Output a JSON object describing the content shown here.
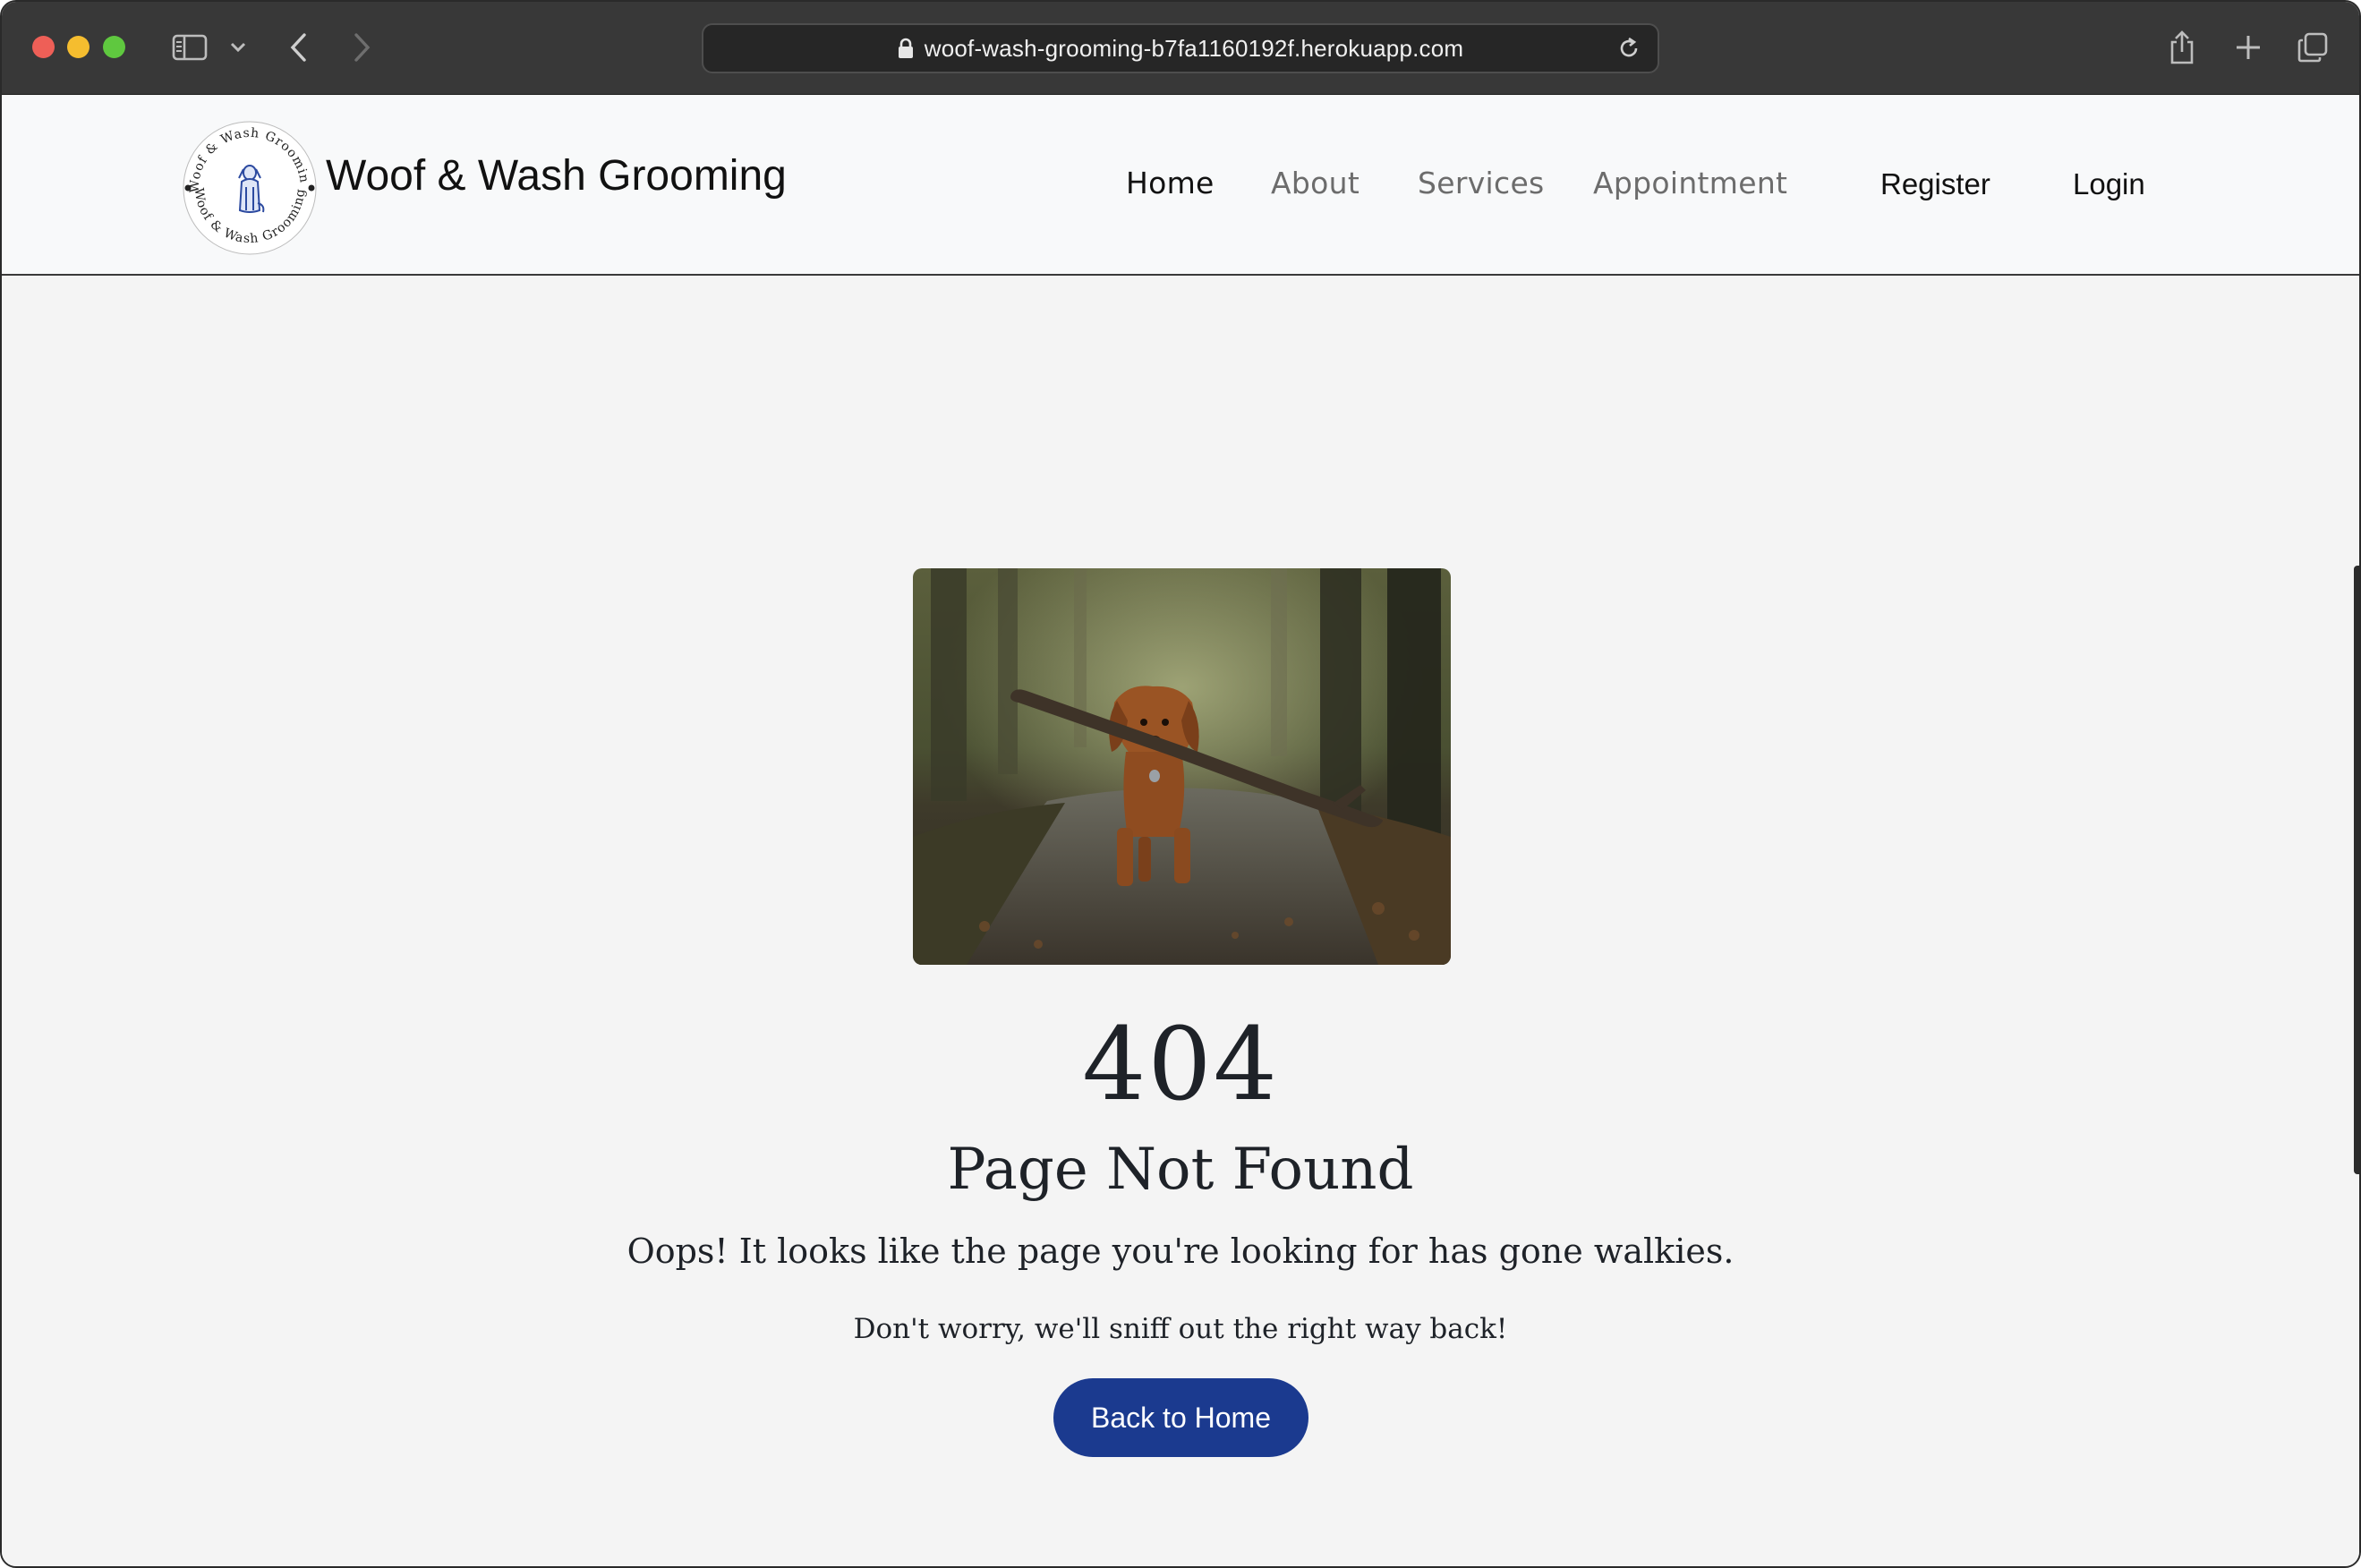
{
  "browser": {
    "url": "woof-wash-grooming-b7fa1160192f.herokuapp.com",
    "icons": [
      "sidebar-icon",
      "chevron-down-icon",
      "back-arrow-icon",
      "forward-arrow-icon",
      "lock-icon",
      "reload-icon",
      "share-icon",
      "plus-icon",
      "tabs-overview-icon"
    ]
  },
  "header": {
    "brand": "Woof & Wash Grooming",
    "logo_text": "Woof & Wash Grooming",
    "nav": [
      {
        "label": "Home",
        "active": true
      },
      {
        "label": "About",
        "active": false
      },
      {
        "label": "Services",
        "active": false
      },
      {
        "label": "Appointment",
        "active": false
      }
    ],
    "register": "Register",
    "login": "Login"
  },
  "error": {
    "code": "404",
    "title": "Page Not Found",
    "subtitle": "Oops! It looks like the page you're looking for has gone walkies.",
    "note": "Don't worry, we'll sniff out the right way back!",
    "button": "Back to Home"
  },
  "colors": {
    "chrome": "#383838",
    "header_bg": "#f8f9fa",
    "page_bg": "#f4f4f4",
    "button": "#1b3a8f",
    "text": "#1e2228"
  }
}
